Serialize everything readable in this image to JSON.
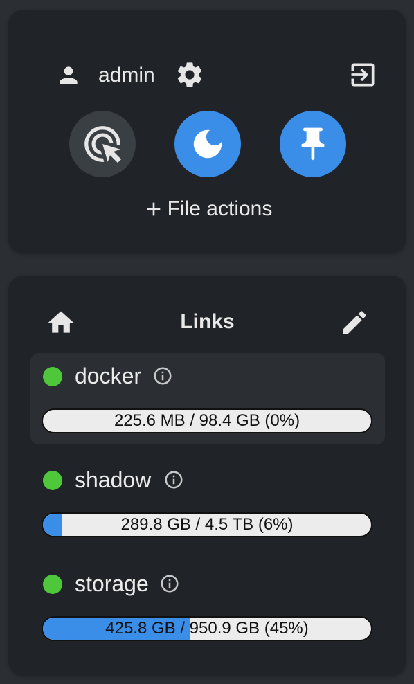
{
  "user": {
    "username": "admin"
  },
  "actions": {
    "file_actions_label": "File actions"
  },
  "links_panel": {
    "title": "Links",
    "items": [
      {
        "name": "docker",
        "usage": "225.6 MB / 98.4 GB (0%)",
        "percent": 0,
        "status": "online",
        "status_color": "#4ec73a"
      },
      {
        "name": "shadow",
        "usage": "289.8 GB / 4.5 TB (6%)",
        "percent": 6,
        "status": "online",
        "status_color": "#4ec73a"
      },
      {
        "name": "storage",
        "usage": "425.8 GB / 950.9 GB (45%)",
        "percent": 45,
        "status": "online",
        "status_color": "#4ec73a"
      }
    ]
  },
  "colors": {
    "accent": "#3b8ee8",
    "background": "#2b2f34",
    "card": "#202428",
    "status_online": "#4ec73a"
  }
}
